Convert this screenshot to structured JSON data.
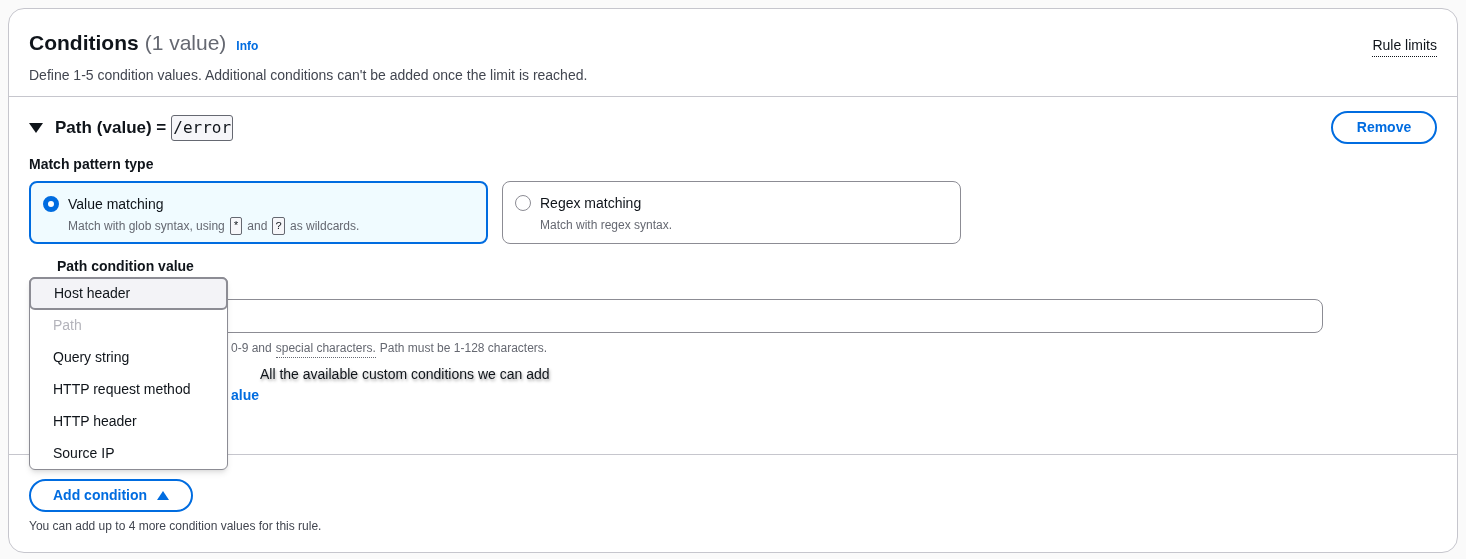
{
  "header": {
    "title": "Conditions",
    "count": "(1 value)",
    "info_link": "Info",
    "rule_limits": "Rule limits",
    "description": "Define 1-5 condition values. Additional conditions can't be added once the limit is reached."
  },
  "condition": {
    "expanded": true,
    "field": "Path",
    "qualifier": "(value) =",
    "value": "/error",
    "remove_button": "Remove",
    "match_pattern": {
      "label": "Match pattern type",
      "options": [
        {
          "title": "Value matching",
          "description_before": "Match with glob syntax, using",
          "key_1": "*",
          "description_middle": "and",
          "key_2": "?",
          "description_after": "as wildcards.",
          "selected": true
        },
        {
          "title": "Regex matching",
          "description_before": "Match with regex syntax.",
          "selected": false
        }
      ]
    },
    "value_label": "Path condition value",
    "hint_before": "0-9 and",
    "hint_link": "special characters.",
    "hint_after": "Path must be 1-128 characters.",
    "add_value_link": "alue"
  },
  "annotation": "All the available custom conditions we can add",
  "menu": [
    {
      "label": "Host header",
      "highlighted": true,
      "disabled": false
    },
    {
      "label": "Path",
      "highlighted": false,
      "disabled": true
    },
    {
      "label": "Query string",
      "highlighted": false,
      "disabled": false
    },
    {
      "label": "HTTP request method",
      "highlighted": false,
      "disabled": false
    },
    {
      "label": "HTTP header",
      "highlighted": false,
      "disabled": false
    },
    {
      "label": "Source IP",
      "highlighted": false,
      "disabled": false
    }
  ],
  "add_condition": {
    "label": "Add condition",
    "expanded": true
  },
  "footer": "You can add up to 4 more condition values for this rule."
}
